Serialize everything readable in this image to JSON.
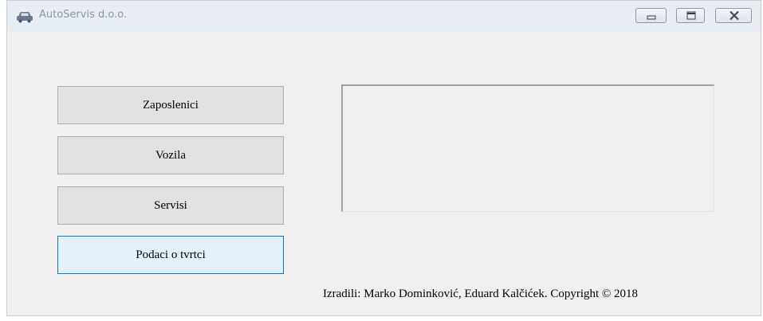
{
  "window": {
    "title": "AutoServis d.o.o.",
    "app_icon": "car-icon",
    "controls": {
      "minimize_icon": "minimize-icon",
      "maximize_icon": "maximize-icon",
      "close_icon": "close-icon"
    }
  },
  "menu": {
    "buttons": [
      {
        "label": "Zaposlenici"
      },
      {
        "label": "Vozila"
      },
      {
        "label": "Servisi"
      },
      {
        "label": "Podaci o tvrtci",
        "focused": true
      }
    ]
  },
  "footer": {
    "credits": "Izradili: Marko Dominković, Eduard Kalčićek. Copyright © 2018"
  },
  "colors": {
    "titlebar_bg": "#e9eef5",
    "window_bg": "#f0f0f0",
    "button_bg": "#e1e1e1",
    "focus_border": "#0078d7",
    "focus_bg": "#e5f1fb"
  }
}
